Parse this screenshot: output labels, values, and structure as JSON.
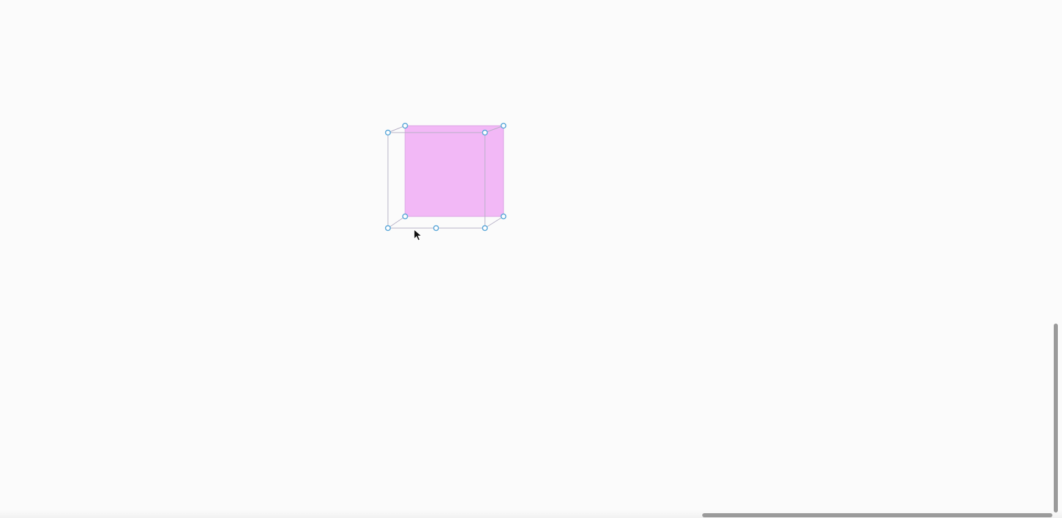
{
  "canvas": {
    "background": "#fbfbfb"
  },
  "cube": {
    "face_fill": "#f2b8f6",
    "face_stroke": "#d9a2e3",
    "edge_color": "#b6b0c6",
    "handle_stroke": "#5aa7d8",
    "handle_fill": "#ffffff",
    "state": "selected"
  },
  "cursor": {
    "icon": "arrow-pointer-icon"
  },
  "scrollbars": {
    "thumb_color": "#9a9a9a"
  }
}
